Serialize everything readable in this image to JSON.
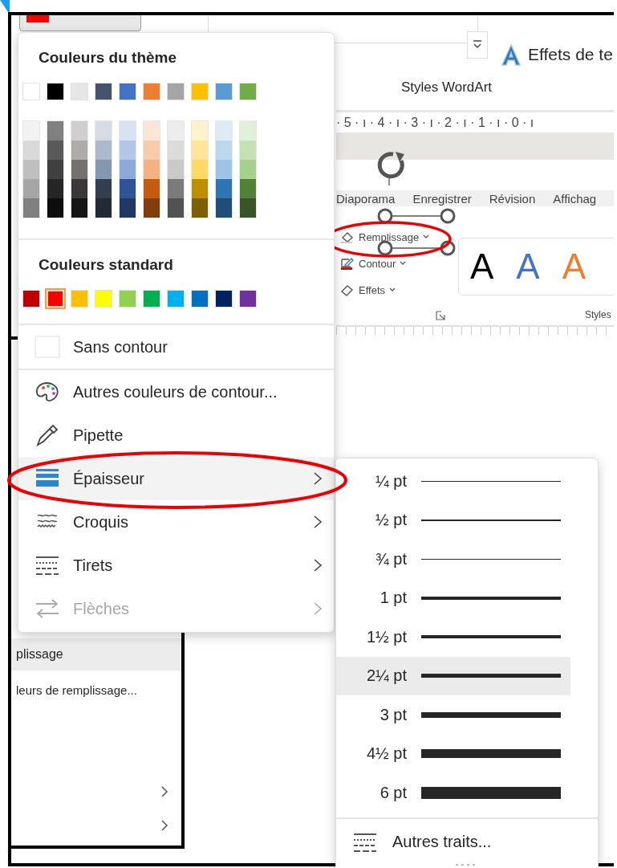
{
  "ribbon": {
    "effects_button": "Effets de te",
    "group_label": "Styles WordArt",
    "ruler": "· 5 · ı · 4 · ı · 3 · ı · 2 · ı · 1 · ı · 0 · ı",
    "tabs": [
      "Diaporama",
      "Enregistrer",
      "Révision",
      "Affichag"
    ],
    "shape_buttons": [
      "Remplissage",
      "Contour",
      "Effets"
    ],
    "styles": [
      {
        "label": "A",
        "color": "#000000"
      },
      {
        "label": "A",
        "color": "#4472c4"
      },
      {
        "label": "A",
        "color": "#ed7d31"
      }
    ],
    "styles_label": "Styles"
  },
  "side_panel": {
    "header": "plissage",
    "item": "leurs de remplissage..."
  },
  "menu": {
    "theme_title": "Couleurs du thème",
    "theme_colors": [
      {
        "color": "#ffffff",
        "selected": false
      },
      {
        "color": "#000000",
        "selected": false
      },
      {
        "color": "#e7e6e6",
        "selected": false
      },
      {
        "color": "#44546a",
        "selected": false
      },
      {
        "color": "#4472c4",
        "selected": false
      },
      {
        "color": "#ed7d31",
        "selected": false
      },
      {
        "color": "#a5a5a5",
        "selected": false
      },
      {
        "color": "#ffc000",
        "selected": false
      },
      {
        "color": "#5b9bd5",
        "selected": false
      },
      {
        "color": "#70ad47",
        "selected": false
      }
    ],
    "shades": [
      [
        {
          "color": "#f2f2f2"
        },
        {
          "color": "#d9d9d9"
        },
        {
          "color": "#bfbfbf"
        },
        {
          "color": "#a6a6a6"
        },
        {
          "color": "#808080"
        }
      ],
      [
        {
          "color": "#808080"
        },
        {
          "color": "#595959"
        },
        {
          "color": "#404040"
        },
        {
          "color": "#262626"
        },
        {
          "color": "#0d0d0d"
        }
      ],
      [
        {
          "color": "#d0cece"
        },
        {
          "color": "#aeabab"
        },
        {
          "color": "#757171"
        },
        {
          "color": "#3a3838"
        },
        {
          "color": "#171616"
        }
      ],
      [
        {
          "color": "#d6dce4"
        },
        {
          "color": "#adb9ca"
        },
        {
          "color": "#8497b0"
        },
        {
          "color": "#333f4f"
        },
        {
          "color": "#222a35"
        }
      ],
      [
        {
          "color": "#d9e2f3"
        },
        {
          "color": "#b4c6e7"
        },
        {
          "color": "#8eaadb"
        },
        {
          "color": "#2f5496"
        },
        {
          "color": "#1f3864"
        }
      ],
      [
        {
          "color": "#fbe5d5"
        },
        {
          "color": "#f7cbac"
        },
        {
          "color": "#f4b183"
        },
        {
          "color": "#c55a11"
        },
        {
          "color": "#833c0b"
        }
      ],
      [
        {
          "color": "#ededed"
        },
        {
          "color": "#dbdbdb"
        },
        {
          "color": "#c9c9c9"
        },
        {
          "color": "#7b7b7b"
        },
        {
          "color": "#525252"
        }
      ],
      [
        {
          "color": "#fff2cc"
        },
        {
          "color": "#ffe599"
        },
        {
          "color": "#ffd966"
        },
        {
          "color": "#bf8f00"
        },
        {
          "color": "#7f6000"
        }
      ],
      [
        {
          "color": "#deebf6"
        },
        {
          "color": "#bdd7ee"
        },
        {
          "color": "#9dc3e6"
        },
        {
          "color": "#2e75b5"
        },
        {
          "color": "#1e4e79"
        }
      ],
      [
        {
          "color": "#e2efd9"
        },
        {
          "color": "#c5e0b3"
        },
        {
          "color": "#a8d08d"
        },
        {
          "color": "#538135"
        },
        {
          "color": "#375623"
        }
      ]
    ],
    "standard_title": "Couleurs standard",
    "standard_colors": [
      {
        "color": "#c00000",
        "selected": false
      },
      {
        "color": "#ff0000",
        "selected": true
      },
      {
        "color": "#ffc000",
        "selected": false
      },
      {
        "color": "#ffff00",
        "selected": false
      },
      {
        "color": "#92d050",
        "selected": false
      },
      {
        "color": "#00b050",
        "selected": false
      },
      {
        "color": "#00b0f0",
        "selected": false
      },
      {
        "color": "#0070c0",
        "selected": false
      },
      {
        "color": "#002060",
        "selected": false
      },
      {
        "color": "#7030a0",
        "selected": false
      }
    ],
    "items": [
      {
        "label": "Sans contour",
        "kind": "command",
        "selected": false,
        "disabled": false
      },
      {
        "label": "Autres couleurs de contour...",
        "kind": "command",
        "selected": false,
        "disabled": false
      },
      {
        "label": "Pipette",
        "kind": "command",
        "selected": false,
        "disabled": false
      },
      {
        "label": "Épaisseur",
        "kind": "submenu",
        "selected": true,
        "disabled": false
      },
      {
        "label": "Croquis",
        "kind": "submenu",
        "selected": false,
        "disabled": false
      },
      {
        "label": "Tirets",
        "kind": "submenu",
        "selected": false,
        "disabled": false
      },
      {
        "label": "Flèches",
        "kind": "submenu",
        "selected": false,
        "disabled": true
      }
    ]
  },
  "submenu": {
    "items": [
      {
        "label": "¼ pt",
        "kind": "hairline",
        "selected": false
      },
      {
        "label": "½ pt",
        "kind": "hairline",
        "selected": false
      },
      {
        "label": "¾ pt",
        "kind": "hairline",
        "selected": false
      },
      {
        "label": "1 pt",
        "kind": "thin",
        "selected": false
      },
      {
        "label": "1½ pt",
        "kind": "thin",
        "selected": false
      },
      {
        "label": "2¼ pt",
        "kind": "medium",
        "selected": true
      },
      {
        "label": "3 pt",
        "kind": "thick",
        "selected": false
      },
      {
        "label": "4½ pt",
        "kind": "heavy",
        "selected": false
      },
      {
        "label": "6 pt",
        "kind": "heaviest",
        "selected": false
      }
    ],
    "more": "Autres traits..."
  }
}
